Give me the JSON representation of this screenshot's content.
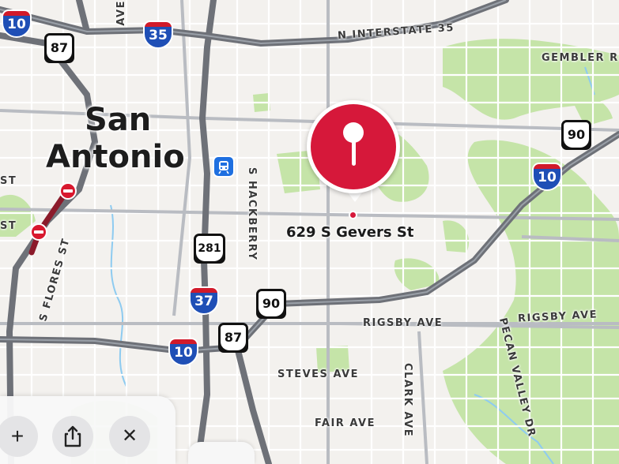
{
  "city_label": [
    "San",
    "Antonio"
  ],
  "selected_place": {
    "address": "629 S Gevers St"
  },
  "streets": {
    "interstate_35": "N INTERSTATE 35",
    "gembler": "GEMBLER RE",
    "rigsby_1": "RIGSBY AVE",
    "rigsby_2": "RIGSBY AVE",
    "steves": "STEVES AVE",
    "fair": "FAIR AVE",
    "hackberry": "S HACKBERRY",
    "clark": "CLARK AVE",
    "pecan_valley": "PECAN VALLEY DR",
    "flores": "S FLORES ST",
    "ave_top": "AVE",
    "st_1": "ST",
    "st_2": "ST"
  },
  "shields": {
    "i10_nw": "10",
    "i35": "35",
    "us87_n": "87",
    "us90_ne": "90",
    "i10_e": "10",
    "us281": "281",
    "i37": "37",
    "us90": "90",
    "us87_s": "87",
    "i10_s": "10"
  },
  "icons": {
    "transit": "train-station-icon",
    "incident": "road-closure-icon",
    "pin": "location-pin-icon",
    "add": "plus-icon",
    "share": "share-icon",
    "close": "close-icon"
  },
  "controls": {
    "add": "+",
    "close": "✕"
  },
  "colors": {
    "pin": "#d6183a",
    "park": "#c5e4a8",
    "interstate": "#1f4fb6",
    "highway": "#6e7178",
    "incident": "#d8182e"
  }
}
